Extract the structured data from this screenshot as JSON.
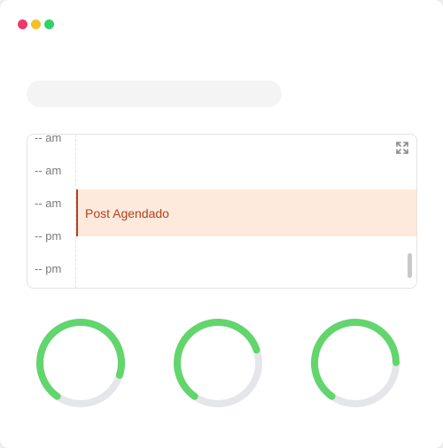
{
  "window": {
    "controls": {
      "close_color": "#ee3a67",
      "minimize_color": "#f3c127",
      "maximize_color": "#32d06b"
    }
  },
  "search": {
    "value": "",
    "placeholder": "",
    "background": "#f4f4f4"
  },
  "calendar": {
    "time_slots": [
      "-- am",
      "-- am",
      "-- am",
      "-- pm",
      "-- pm"
    ],
    "event": {
      "title": "Post Agendado",
      "text_color": "#b5401e",
      "background": "#fdeadc"
    },
    "expand_icon": "expand-icon"
  },
  "gauges": {
    "track_color": "#e5e6ea",
    "fill_color": "#62d56c",
    "items": [
      {
        "name": "gauge-1",
        "value": 0.7
      },
      {
        "name": "gauge-2",
        "value": 0.6
      },
      {
        "name": "gauge-3",
        "value": 0.65
      }
    ]
  }
}
